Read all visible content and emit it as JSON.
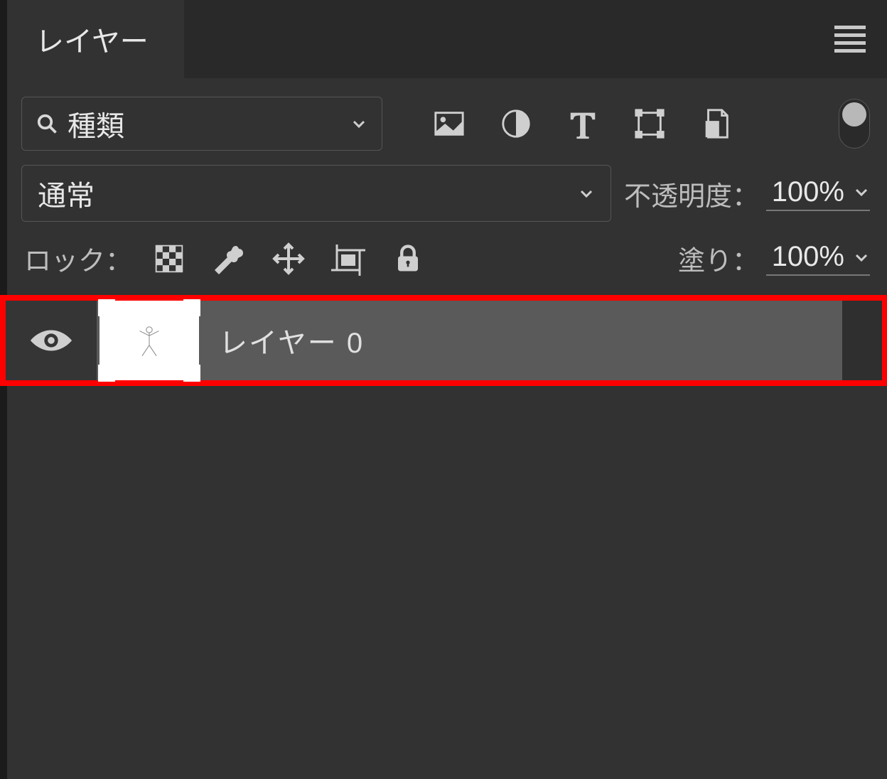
{
  "panel": {
    "tab_title": "レイヤー"
  },
  "filter": {
    "label": "種類"
  },
  "blend": {
    "mode": "通常",
    "opacity_label": "不透明度：",
    "opacity_value": "100%"
  },
  "lock": {
    "label": "ロック：",
    "fill_label": "塗り：",
    "fill_value": "100%"
  },
  "layers": [
    {
      "name": "レイヤー 0",
      "visible": true,
      "selected": true
    }
  ]
}
